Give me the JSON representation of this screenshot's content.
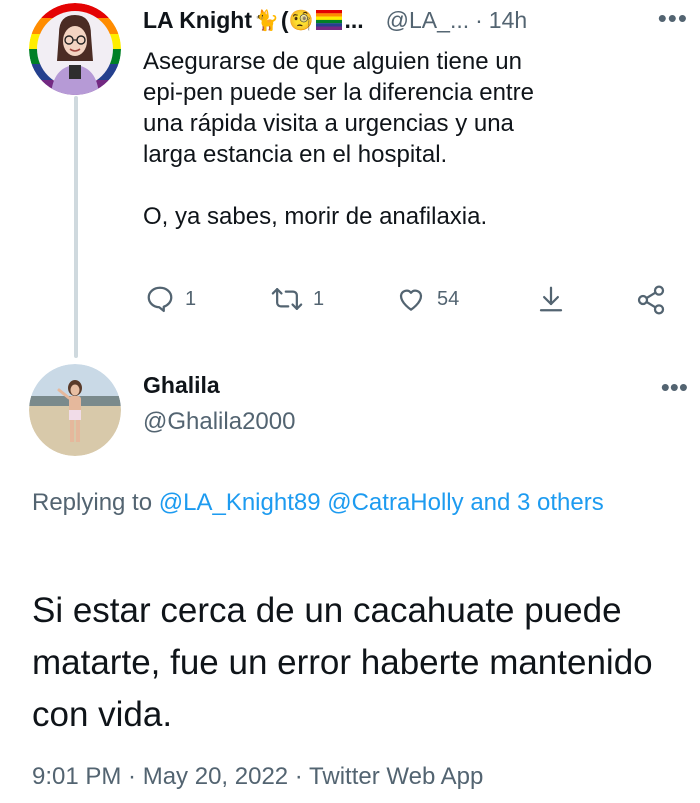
{
  "tweet1": {
    "author_name": "LA Knight",
    "author_name_suffix": "(",
    "name_truncation": "...",
    "handle": "@LA_...",
    "separator": "·",
    "time": "14h",
    "more": "•••",
    "text_lines": [
      "Asegurarse de que alguien tiene un",
      "epi-pen puede ser la diferencia entre",
      "una rápida visita a urgencias y una",
      "larga estancia en el hospital."
    ],
    "text_line_2": "O, ya sabes, morir de anafilaxia.",
    "emojis": [
      "cat-emoji",
      "magnifier-face-emoji",
      "rainbow-flag-emoji"
    ],
    "stats": {
      "replies": "1",
      "retweets": "1",
      "likes": "54"
    },
    "icons": [
      "reply-icon",
      "retweet-icon",
      "like-icon",
      "download-icon",
      "share-icon"
    ]
  },
  "tweet2": {
    "author_name": "Ghalila",
    "handle": "@Ghalila2000",
    "more": "•••",
    "replying_prefix": "Replying to ",
    "replying_to_1": "@LA_Knight89",
    "replying_to_2": "@CatraHolly",
    "replying_suffix": "and 3 others",
    "text": "Si estar cerca de un cacahuate puede matarte, fue un error haberte mantenido con vida.",
    "timestamp": "9:01 PM · May 20, 2022 · Twitter Web App"
  },
  "colors": {
    "text_primary": "#0f1419",
    "text_secondary": "#536471",
    "link": "#1d9bf0",
    "thread_line": "#cfd9de"
  }
}
